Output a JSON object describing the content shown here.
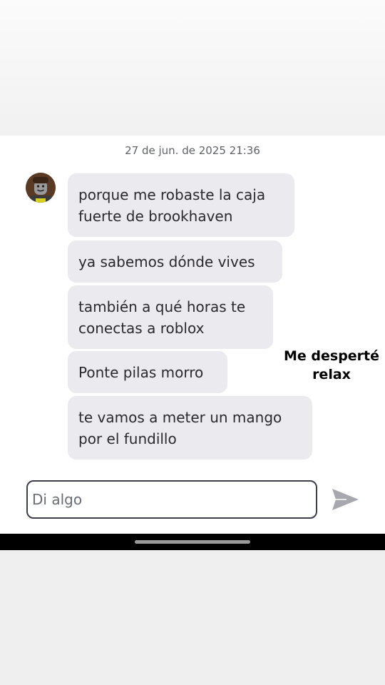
{
  "chat": {
    "timestamp": "27 de jun. de 2025 21:36",
    "messages": [
      "porque me robaste la caja\nfuerte de brookhaven",
      "ya sabemos dónde vives",
      "también a qué horas te\nconectas a roblox",
      "Ponte pilas morro",
      "te vamos a meter un mango\npor el fundillo"
    ]
  },
  "overlay": {
    "caption": "Me desperté\nrelax"
  },
  "composer": {
    "placeholder": "Di algo",
    "send_icon": "send-arrow"
  },
  "colors": {
    "bubble": "#ebebef",
    "text": "#2a2a2e",
    "send_icon": "#a6a8ae"
  }
}
